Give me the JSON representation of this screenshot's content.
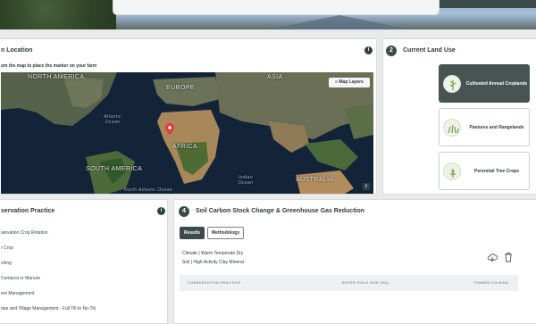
{
  "location": {
    "title": "n Location",
    "instruction": "om the map to place the marker on your farm",
    "map_layers_label": "Map Layers",
    "map_labels": {
      "north_america": "NORTH AMERICA",
      "europe": "EUROPE",
      "asia": "ASIA",
      "africa": "AFRICA",
      "south_america": "SOUTH AMERICA",
      "australia": "AUSTRALIA",
      "atlantic": "Atlantic Ocean",
      "north_atlantic": "North Atlantic Ocean",
      "indian": "Indian Ocean"
    },
    "info_glyph": "i"
  },
  "land_use": {
    "step": "2",
    "title": "Current Land Use",
    "options": [
      {
        "label": "Cultivated Annual Croplands",
        "selected": true
      },
      {
        "label": "Pastures and Rangelands",
        "selected": false
      },
      {
        "label": "Perennial Tree Crops",
        "selected": false
      }
    ]
  },
  "conservation": {
    "title": "servation Practice",
    "info_glyph": "i",
    "items": [
      "servation Crop Rotation",
      "r Crop",
      "ching",
      "Compost or Manure",
      "ent Management",
      "due and Tillage Management - Full Till to No-Till"
    ]
  },
  "soil": {
    "step": "4",
    "title": "Soil Carbon Stock Change & Greenhouse Gas Reduction",
    "tabs": [
      "Results",
      "Methodology"
    ],
    "climate_label": "Climate |",
    "climate_value": "Warm Temperate Dry",
    "soil_label": "Soil |",
    "soil_value": "High Activity Clay Mineral",
    "table_headers": [
      "CONSERVATION PRACTICE",
      "ENTER FIELD SIZE (HA)",
      "TONNES CO₂E/HA"
    ]
  },
  "colors": {
    "accent_dark": "#3b4a4a",
    "selected_card": "#475453",
    "marker": "#e23b3b"
  }
}
